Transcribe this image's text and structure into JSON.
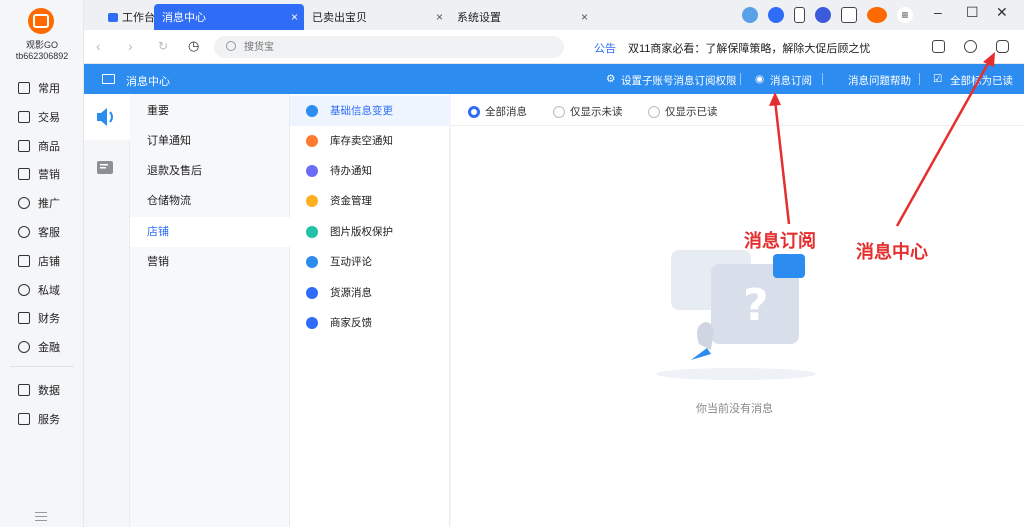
{
  "user": {
    "name": "观影GO",
    "id": "tb662306892"
  },
  "sidebar": {
    "items": [
      {
        "label": "常用",
        "icon": "bookmark-icon"
      },
      {
        "label": "交易",
        "icon": "receipt-icon"
      },
      {
        "label": "商品",
        "icon": "box-icon"
      },
      {
        "label": "营销",
        "icon": "ticket-icon"
      },
      {
        "label": "推广",
        "icon": "send-icon"
      },
      {
        "label": "客服",
        "icon": "headset-icon"
      },
      {
        "label": "店铺",
        "icon": "store-icon"
      },
      {
        "label": "私域",
        "icon": "people-icon"
      },
      {
        "label": "财务",
        "icon": "wallet-icon"
      },
      {
        "label": "金融",
        "icon": "finance-icon"
      },
      {
        "label": "数据",
        "icon": "chart-icon"
      },
      {
        "label": "服务",
        "icon": "service-icon"
      }
    ]
  },
  "tabs": [
    {
      "label": "工作台"
    },
    {
      "label": "消息中心",
      "active": true
    },
    {
      "label": "已卖出宝贝"
    },
    {
      "label": "系统设置"
    }
  ],
  "addressbar": {
    "search_placeholder": "搜货宝",
    "notice_label": "公告",
    "notice_text": "双11商家必看：了解保障策略，解除大促后顾之忧"
  },
  "message_header": {
    "title": "消息中心",
    "links": {
      "permission": "设置子账号消息订阅权限",
      "subscribe": "消息订阅",
      "help": "消息问题帮助",
      "mark_read": "全部标为已读"
    }
  },
  "categories": [
    {
      "label": "重要"
    },
    {
      "label": "订单通知"
    },
    {
      "label": "退款及售后"
    },
    {
      "label": "仓储物流"
    },
    {
      "label": "店铺",
      "active": true
    },
    {
      "label": "营销"
    }
  ],
  "subcategories": [
    {
      "label": "基础信息变更",
      "color": "#2d8cf0",
      "active": true
    },
    {
      "label": "库存卖空通知",
      "color": "#ff7a2e"
    },
    {
      "label": "待办通知",
      "color": "#6b6cf6"
    },
    {
      "label": "资金管理",
      "color": "#ffb020"
    },
    {
      "label": "图片版权保护",
      "color": "#23c1a6"
    },
    {
      "label": "互动评论",
      "color": "#2d8cf0"
    },
    {
      "label": "货源消息",
      "color": "#2f6df6"
    },
    {
      "label": "商家反馈",
      "color": "#2f6df6"
    }
  ],
  "filters": [
    {
      "label": "全部消息",
      "checked": true
    },
    {
      "label": "仅显示未读",
      "checked": false
    },
    {
      "label": "仅显示已读",
      "checked": false
    }
  ],
  "empty_state": "你当前没有消息",
  "annotations": {
    "subscribe": "消息订阅",
    "center": "消息中心",
    "color": "#e52f2f"
  }
}
